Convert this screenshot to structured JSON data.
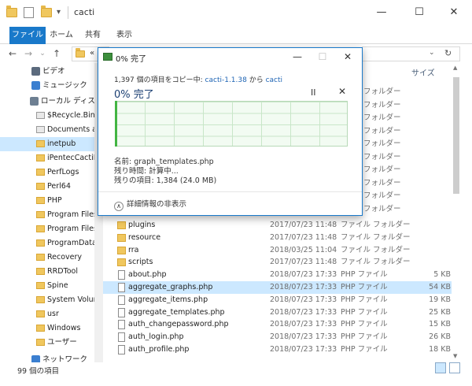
{
  "window": {
    "title": "cacti",
    "controls": {
      "minimize": "—",
      "maximize": "☐",
      "close": "✕"
    }
  },
  "ribbon": {
    "tabs": [
      "ファイル",
      "ホーム",
      "共有",
      "表示"
    ]
  },
  "address": {
    "nav_back": "←",
    "nav_forward": "→",
    "nav_recent": "⌄",
    "nav_up": "↑",
    "path_visible": "«",
    "search_chevron": "⌄",
    "refresh": "↻"
  },
  "nav_pane": {
    "items": [
      {
        "label": "ビデオ",
        "icon": "video-icon"
      },
      {
        "label": "ミュージック",
        "icon": "music-icon"
      },
      {
        "label": "ローカル ディスク (C",
        "icon": "drive-icon"
      },
      {
        "label": "$Recycle.Bin",
        "icon": "recycle-icon"
      },
      {
        "label": "Documents and",
        "icon": "folder-shortcut-icon"
      },
      {
        "label": "inetpub",
        "icon": "folder-icon",
        "selected": true
      },
      {
        "label": "iPentecCactiPo",
        "icon": "folder-icon"
      },
      {
        "label": "PerfLogs",
        "icon": "folder-icon"
      },
      {
        "label": "Perl64",
        "icon": "folder-icon"
      },
      {
        "label": "PHP",
        "icon": "folder-icon"
      },
      {
        "label": "Program Files",
        "icon": "folder-icon"
      },
      {
        "label": "Program Files (",
        "icon": "folder-icon"
      },
      {
        "label": "ProgramData",
        "icon": "folder-icon"
      },
      {
        "label": "Recovery",
        "icon": "folder-icon"
      },
      {
        "label": "RRDTool",
        "icon": "folder-icon"
      },
      {
        "label": "Spine",
        "icon": "folder-icon"
      },
      {
        "label": "System Volume",
        "icon": "folder-icon"
      },
      {
        "label": "usr",
        "icon": "folder-icon"
      },
      {
        "label": "Windows",
        "icon": "folder-icon"
      },
      {
        "label": "ユーザー",
        "icon": "folder-icon"
      },
      {
        "label": "ネットワーク",
        "icon": "network-icon"
      }
    ]
  },
  "file_list": {
    "size_header": "サイズ",
    "hidden_types": [
      "フォルダー",
      "フォルダー",
      "フォルダー",
      "フォルダー",
      "フォルダー",
      "フォルダー",
      "フォルダー",
      "フォルダー",
      "フォルダー",
      "フォルダー"
    ],
    "rows": [
      {
        "name": "plugins",
        "date": "2017/07/23 11:48",
        "type": "ファイル フォルダー",
        "size": "",
        "kind": "folder"
      },
      {
        "name": "resource",
        "date": "2017/07/23 11:48",
        "type": "ファイル フォルダー",
        "size": "",
        "kind": "folder"
      },
      {
        "name": "rra",
        "date": "2018/03/25 11:04",
        "type": "ファイル フォルダー",
        "size": "",
        "kind": "folder"
      },
      {
        "name": "scripts",
        "date": "2017/07/23 11:48",
        "type": "ファイル フォルダー",
        "size": "",
        "kind": "folder"
      },
      {
        "name": "about.php",
        "date": "2018/07/23 17:33",
        "type": "PHP ファイル",
        "size": "5 KB",
        "kind": "file"
      },
      {
        "name": "aggregate_graphs.php",
        "date": "2018/07/23 17:33",
        "type": "PHP ファイル",
        "size": "54 KB",
        "kind": "file",
        "selected": true
      },
      {
        "name": "aggregate_items.php",
        "date": "2018/07/23 17:33",
        "type": "PHP ファイル",
        "size": "19 KB",
        "kind": "file"
      },
      {
        "name": "aggregate_templates.php",
        "date": "2018/07/23 17:33",
        "type": "PHP ファイル",
        "size": "25 KB",
        "kind": "file"
      },
      {
        "name": "auth_changepassword.php",
        "date": "2018/07/23 17:33",
        "type": "PHP ファイル",
        "size": "15 KB",
        "kind": "file"
      },
      {
        "name": "auth_login.php",
        "date": "2018/07/23 17:33",
        "type": "PHP ファイル",
        "size": "26 KB",
        "kind": "file"
      },
      {
        "name": "auth_profile.php",
        "date": "2018/07/23 17:33",
        "type": "PHP ファイル",
        "size": "18 KB",
        "kind": "file"
      }
    ]
  },
  "status_bar": {
    "count": "99 個の項目"
  },
  "copy_dialog": {
    "title": "0% 完了",
    "controls": {
      "minimize": "—",
      "maximize": "☐",
      "close": "✕"
    },
    "desc_prefix": "1,397 個の項目をコピー中: ",
    "source": "cacti-1.1.38",
    "desc_mid": " から ",
    "destination": "cacti",
    "percent_text": "0% 完了",
    "progress": 0,
    "pause": "II",
    "cancel": "✕",
    "name_line": "名前: graph_templates.php",
    "time_line": "残り時間: 計算中...",
    "items_line": "残りの項目: 1,384 (24.0 MB)",
    "fewer_details": "詳細情報の非表示",
    "fewer_chevron": "∧"
  }
}
